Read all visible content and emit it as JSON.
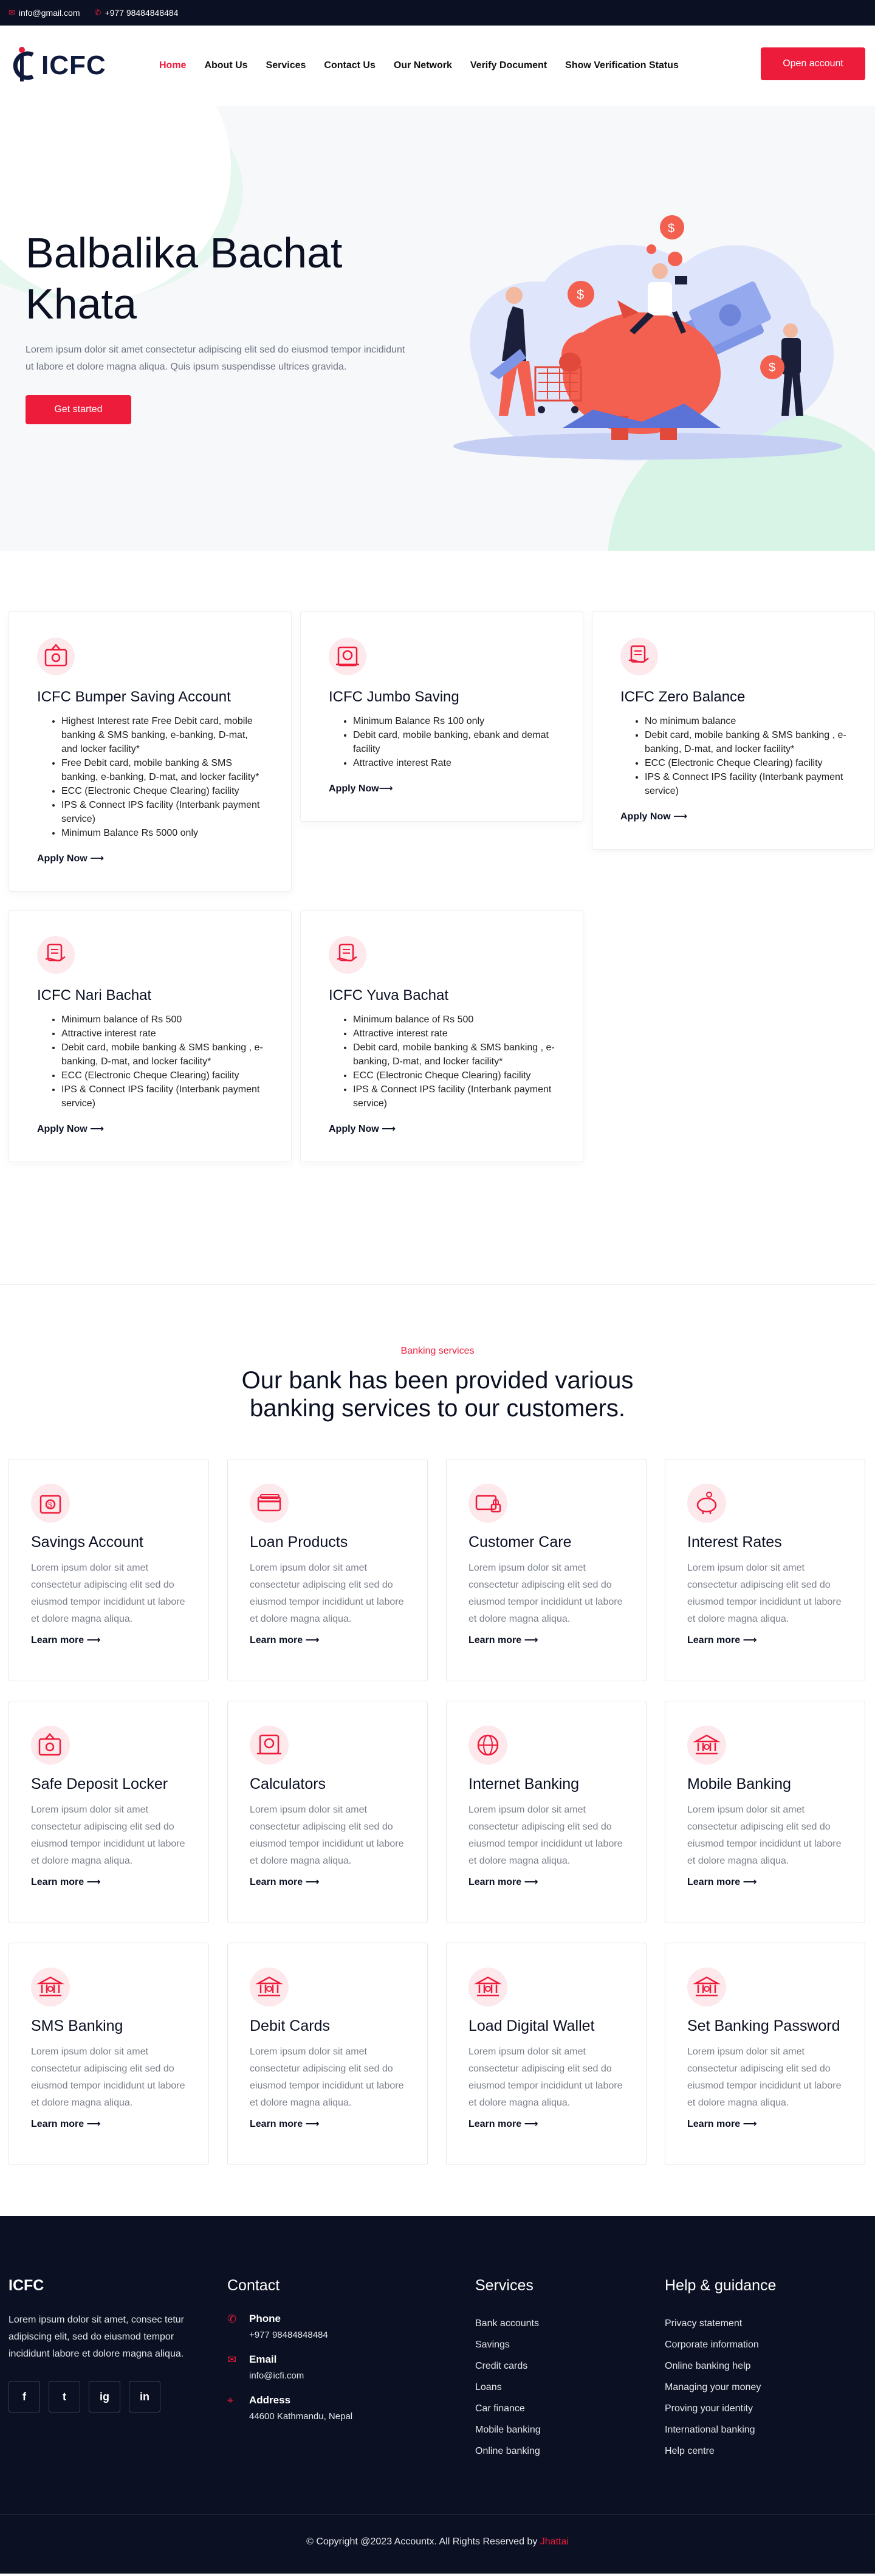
{
  "topbar": {
    "email": "info@gmail.com",
    "phone": "+977 98484848484"
  },
  "brand": {
    "name": "ICFC",
    "accent": "#ee1c3b",
    "dark": "#0b1023"
  },
  "nav": {
    "items": [
      "Home",
      "About Us",
      "Services",
      "Contact Us",
      "Our Network",
      "Verify Document",
      "Show Verification Status"
    ],
    "active": "Home",
    "cta": "Open account"
  },
  "hero": {
    "title": "Balbalika Bachat Khata",
    "text": "Lorem ipsum dolor sit amet consectetur adipiscing elit sed do eiusmod tempor incididunt ut labore et dolore magna aliqua. Quis ipsum suspendisse ultrices gravida.",
    "cta": "Get started"
  },
  "accounts": [
    {
      "title": "ICFC Bumper Saving Account",
      "icon": "safe-icon",
      "features": [
        "Highest Interest rate Free Debit card, mobile banking & SMS banking, e-banking, D-mat, and locker facility*",
        "Free Debit card, mobile banking & SMS banking, e-banking, D-mat, and locker facility*",
        "ECC (Electronic Cheque Clearing) facility",
        "IPS & Connect IPS facility (Interbank payment service)",
        "Minimum Balance Rs 5000 only"
      ],
      "link": "Apply Now"
    },
    {
      "title": "ICFC Jumbo Saving",
      "icon": "calculator-icon",
      "features": [
        "Minimum Balance Rs 100 only",
        "Debit card, mobile banking, ebank and demat facility",
        "Attractive interest Rate"
      ],
      "link": "Apply Now"
    },
    {
      "title": "ICFC Zero Balance",
      "icon": "hand-card-icon",
      "features": [
        "No minimum balance",
        "Debit card, mobile banking & SMS banking , e- banking, D-mat, and locker facility*",
        "ECC (Electronic Cheque Clearing) facility",
        "IPS & Connect IPS facility (Interbank payment service)"
      ],
      "link": "Apply Now"
    },
    {
      "title": "ICFC Nari Bachat",
      "icon": "hand-card-icon",
      "features": [
        "Minimum balance of Rs 500",
        "Attractive interest rate",
        "Debit card, mobile banking & SMS banking , e- banking, D-mat, and locker facility*",
        "ECC (Electronic Cheque Clearing) facility",
        "IPS & Connect IPS facility (Interbank payment service)"
      ],
      "link": "Apply Now"
    },
    {
      "title": "ICFC Yuva Bachat",
      "icon": "hand-card-icon",
      "features": [
        "Minimum balance of Rs 500",
        "Attractive interest rate",
        "Debit card, mobile banking & SMS banking , e- banking, D-mat, and locker facility*",
        "ECC (Electronic Cheque Clearing) facility",
        "IPS & Connect IPS facility (Interbank payment service)"
      ],
      "link": "Apply Now"
    }
  ],
  "services": {
    "eyebrow": "Banking services",
    "heading": "Our bank has been provided various banking services to our customers.",
    "items": [
      {
        "title": "Savings Account",
        "icon": "bank-safe-icon",
        "text": "Lorem ipsum dolor sit amet consectetur adipiscing elit sed do eiusmod tempor incididunt ut labore et dolore magna aliqua.",
        "link": "Learn more"
      },
      {
        "title": "Loan Products",
        "icon": "card-icon",
        "text": "Lorem ipsum dolor sit amet consectetur adipiscing elit sed do eiusmod tempor incididunt ut labore et dolore magna aliqua.",
        "link": "Learn more"
      },
      {
        "title": "Customer Care",
        "icon": "card-lock-icon",
        "text": "Lorem ipsum dolor sit amet consectetur adipiscing elit sed do eiusmod tempor incididunt ut labore et dolore magna aliqua.",
        "link": "Learn more"
      },
      {
        "title": "Interest Rates",
        "icon": "piggy-bank-icon",
        "text": "Lorem ipsum dolor sit amet consectetur adipiscing elit sed do eiusmod tempor incididunt ut labore et dolore magna aliqua.",
        "link": "Learn more"
      },
      {
        "title": "Safe Deposit Locker",
        "icon": "safe-icon",
        "text": "Lorem ipsum dolor sit amet consectetur adipiscing elit sed do eiusmod tempor incididunt ut labore et dolore magna aliqua.",
        "link": "Learn more"
      },
      {
        "title": "Calculators",
        "icon": "calculator-icon",
        "text": "Lorem ipsum dolor sit amet consectetur adipiscing elit sed do eiusmod tempor incididunt ut labore et dolore magna aliqua.",
        "link": "Learn more"
      },
      {
        "title": "Internet Banking",
        "icon": "globe-icon",
        "text": "Lorem ipsum dolor sit amet consectetur adipiscing elit sed do eiusmod tempor incididunt ut labore et dolore magna aliqua.",
        "link": "Learn more"
      },
      {
        "title": "Mobile Banking",
        "icon": "bank-building-icon",
        "text": "Lorem ipsum dolor sit amet consectetur adipiscing elit sed do eiusmod tempor incididunt ut labore et dolore magna aliqua.",
        "link": "Learn more"
      },
      {
        "title": "SMS Banking",
        "icon": "bank-building-icon",
        "text": "Lorem ipsum dolor sit amet consectetur adipiscing elit sed do eiusmod tempor incididunt ut labore et dolore magna aliqua.",
        "link": "Learn more"
      },
      {
        "title": "Debit Cards",
        "icon": "bank-building-icon",
        "text": "Lorem ipsum dolor sit amet consectetur adipiscing elit sed do eiusmod tempor incididunt ut labore et dolore magna aliqua.",
        "link": "Learn more"
      },
      {
        "title": "Load Digital Wallet",
        "icon": "bank-building-icon",
        "text": "Lorem ipsum dolor sit amet consectetur adipiscing elit sed do eiusmod tempor incididunt ut labore et dolore magna aliqua.",
        "link": "Learn more"
      },
      {
        "title": "Set Banking Password",
        "icon": "bank-building-icon",
        "text": "Lorem ipsum dolor sit amet consectetur adipiscing elit sed do eiusmod tempor incididunt ut labore et dolore magna aliqua.",
        "link": "Learn more"
      }
    ]
  },
  "footer": {
    "brand": "ICFC",
    "about": "Lorem ipsum dolor sit amet, consec tetur adipiscing elit, sed do eiusmod tempor incididunt labore et dolore magna aliqua.",
    "socials": [
      "f",
      "t",
      "ig",
      "in"
    ],
    "contact_title": "Contact",
    "contacts": [
      {
        "label": "Phone",
        "value": "+977 98484848484",
        "icon": "phone-icon"
      },
      {
        "label": "Email",
        "value": "info@icfi.com",
        "icon": "email-icon"
      },
      {
        "label": "Address",
        "value": "44600 Kathmandu, Nepal",
        "icon": "location-icon"
      }
    ],
    "services_title": "Services",
    "services_links": [
      "Bank accounts",
      "Savings",
      "Credit cards",
      "Loans",
      "Car finance",
      "Mobile banking",
      "Online banking"
    ],
    "help_title": "Help & guidance",
    "help_links": [
      "Privacy statement",
      "Corporate information",
      "Online banking help",
      "Managing your money",
      "Proving your identity",
      "International banking",
      "Help centre"
    ],
    "copyright": "© Copyright @2023 Accountx. All Rights Reserved by",
    "copyright_brand": "Jhattai"
  }
}
